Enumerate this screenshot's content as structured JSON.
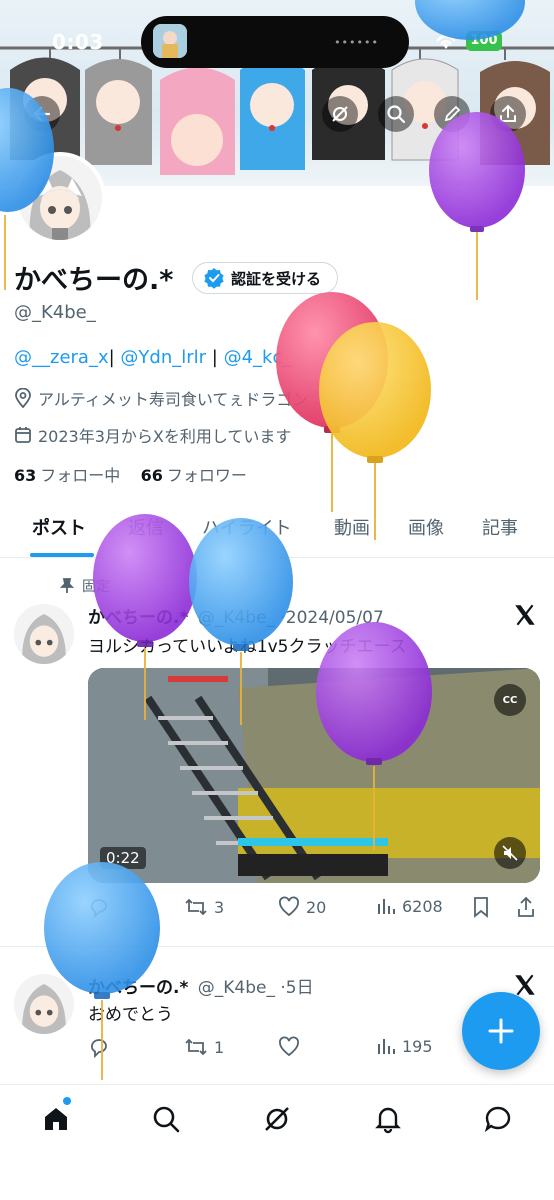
{
  "status_bar": {
    "time": "0:03",
    "battery": "100"
  },
  "profile": {
    "name": "かべちーの.*",
    "verify_label": "認証を受ける",
    "handle": "@_K4be_",
    "bio_links": [
      "@__zera_x",
      "@Ydn_lrlr",
      "@4_kc_"
    ],
    "bio_separator": "|",
    "location": "アルティメット寿司食いてぇドラゴン",
    "joined": "2023年3月からXを利用しています",
    "following_count": "63",
    "following_label": "フォロー中",
    "followers_count": "66",
    "followers_label": "フォロワー"
  },
  "tabs": [
    "ポスト",
    "返信",
    "ハイライト",
    "動画",
    "画像",
    "記事"
  ],
  "posts": [
    {
      "pinned_label": "固定",
      "name": "かべちーの.*",
      "handle": "@_K4be_",
      "date": "·2024/05/07",
      "text": "ヨルシカっていいよね1v5クラッチエース",
      "video_duration": "0:22",
      "reposts": "3",
      "likes": "20",
      "views": "6208"
    },
    {
      "name": "かべちーの.*",
      "handle": "@_K4be_",
      "date": "·5日",
      "text": "おめでとう",
      "reposts": "1",
      "likes": "",
      "views": "195"
    }
  ],
  "icons": {
    "back": "back-arrow-icon",
    "grok": "grok-icon",
    "search": "search-icon",
    "compose": "pencil-icon",
    "share": "share-icon",
    "verified": "verified-badge-icon",
    "location": "location-pin-icon",
    "calendar": "calendar-icon",
    "pin": "pin-icon",
    "x_logo": "x-logo-icon",
    "fab_plus": "plus-icon"
  },
  "colors": {
    "accent": "#1d9bf0",
    "text_primary": "#0f1419",
    "text_secondary": "#536471",
    "balloon_pink": "#ee4577",
    "balloon_yellow": "#f8c92c",
    "balloon_purple": "#a142e6",
    "balloon_blue": "#3ba2f3"
  }
}
